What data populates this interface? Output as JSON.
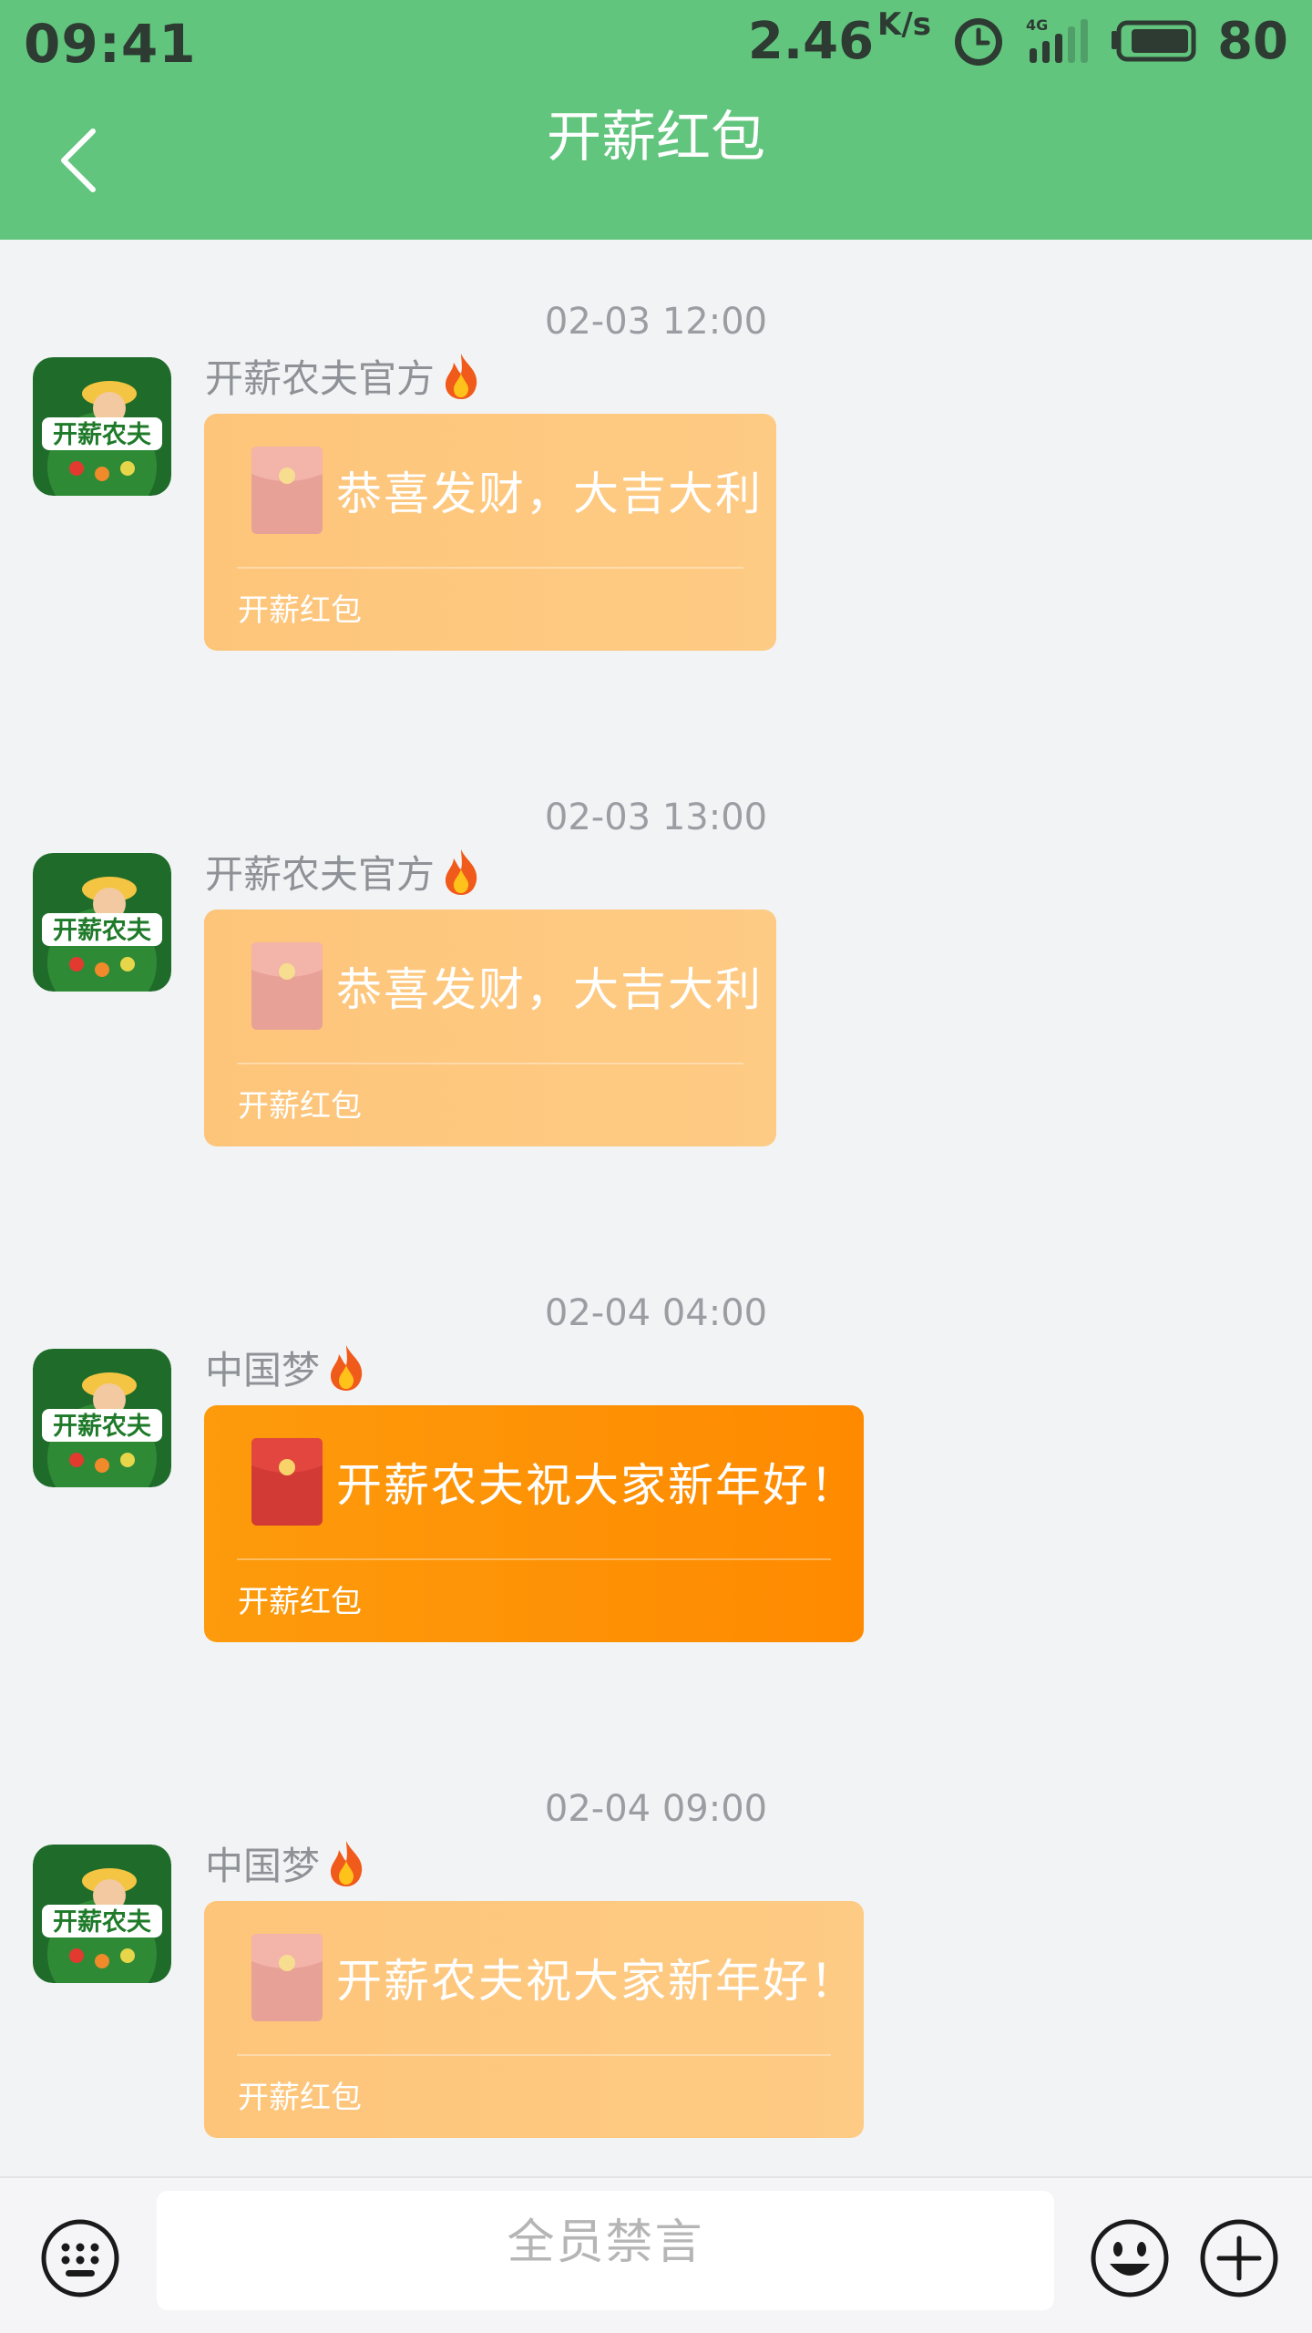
{
  "status_bar": {
    "time": "09:41",
    "net_speed": "2.46",
    "net_unit": "K/s",
    "network_type": "4G",
    "battery": "80"
  },
  "nav": {
    "title": "开薪红包",
    "back_icon": "chevron-left-icon"
  },
  "colors": {
    "header": "#62c57e",
    "packet_opened": "#fdc57a",
    "packet_unopened": "#fd9b0c",
    "background": "#f2f3f5"
  },
  "messages": [
    {
      "time": "02-03 12:00",
      "sender": "开薪农夫官方",
      "packet_text": "恭喜发财，大吉大利",
      "packet_label": "开薪红包",
      "state": "opened"
    },
    {
      "time": "02-03 13:00",
      "sender": "开薪农夫官方",
      "packet_text": "恭喜发财，大吉大利",
      "packet_label": "开薪红包",
      "state": "opened"
    },
    {
      "time": "02-04 04:00",
      "sender": "中国梦",
      "packet_text": "开薪农夫祝大家新年好！",
      "packet_label": "开薪红包",
      "state": "unopened"
    },
    {
      "time": "02-04 09:00",
      "sender": "中国梦",
      "packet_text": "开薪农夫祝大家新年好！",
      "packet_label": "开薪红包",
      "state": "opened"
    }
  ],
  "avatar_logo_text": "开薪农夫",
  "input_bar": {
    "placeholder": "全员禁言",
    "keyboard_icon": "keyboard-icon",
    "emoji_icon": "emoji-icon",
    "plus_icon": "plus-icon"
  }
}
